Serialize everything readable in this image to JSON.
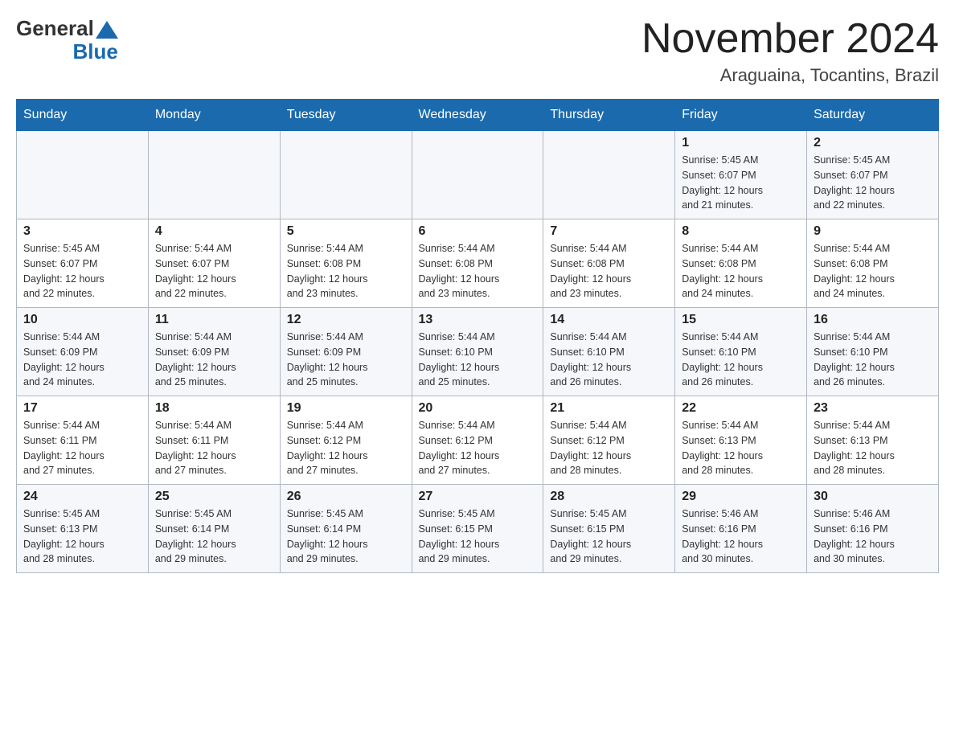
{
  "header": {
    "logo_general": "General",
    "logo_blue": "Blue",
    "month_title": "November 2024",
    "location": "Araguaina, Tocantins, Brazil"
  },
  "weekdays": [
    "Sunday",
    "Monday",
    "Tuesday",
    "Wednesday",
    "Thursday",
    "Friday",
    "Saturday"
  ],
  "rows": [
    [
      {
        "day": "",
        "info": ""
      },
      {
        "day": "",
        "info": ""
      },
      {
        "day": "",
        "info": ""
      },
      {
        "day": "",
        "info": ""
      },
      {
        "day": "",
        "info": ""
      },
      {
        "day": "1",
        "info": "Sunrise: 5:45 AM\nSunset: 6:07 PM\nDaylight: 12 hours\nand 21 minutes."
      },
      {
        "day": "2",
        "info": "Sunrise: 5:45 AM\nSunset: 6:07 PM\nDaylight: 12 hours\nand 22 minutes."
      }
    ],
    [
      {
        "day": "3",
        "info": "Sunrise: 5:45 AM\nSunset: 6:07 PM\nDaylight: 12 hours\nand 22 minutes."
      },
      {
        "day": "4",
        "info": "Sunrise: 5:44 AM\nSunset: 6:07 PM\nDaylight: 12 hours\nand 22 minutes."
      },
      {
        "day": "5",
        "info": "Sunrise: 5:44 AM\nSunset: 6:08 PM\nDaylight: 12 hours\nand 23 minutes."
      },
      {
        "day": "6",
        "info": "Sunrise: 5:44 AM\nSunset: 6:08 PM\nDaylight: 12 hours\nand 23 minutes."
      },
      {
        "day": "7",
        "info": "Sunrise: 5:44 AM\nSunset: 6:08 PM\nDaylight: 12 hours\nand 23 minutes."
      },
      {
        "day": "8",
        "info": "Sunrise: 5:44 AM\nSunset: 6:08 PM\nDaylight: 12 hours\nand 24 minutes."
      },
      {
        "day": "9",
        "info": "Sunrise: 5:44 AM\nSunset: 6:08 PM\nDaylight: 12 hours\nand 24 minutes."
      }
    ],
    [
      {
        "day": "10",
        "info": "Sunrise: 5:44 AM\nSunset: 6:09 PM\nDaylight: 12 hours\nand 24 minutes."
      },
      {
        "day": "11",
        "info": "Sunrise: 5:44 AM\nSunset: 6:09 PM\nDaylight: 12 hours\nand 25 minutes."
      },
      {
        "day": "12",
        "info": "Sunrise: 5:44 AM\nSunset: 6:09 PM\nDaylight: 12 hours\nand 25 minutes."
      },
      {
        "day": "13",
        "info": "Sunrise: 5:44 AM\nSunset: 6:10 PM\nDaylight: 12 hours\nand 25 minutes."
      },
      {
        "day": "14",
        "info": "Sunrise: 5:44 AM\nSunset: 6:10 PM\nDaylight: 12 hours\nand 26 minutes."
      },
      {
        "day": "15",
        "info": "Sunrise: 5:44 AM\nSunset: 6:10 PM\nDaylight: 12 hours\nand 26 minutes."
      },
      {
        "day": "16",
        "info": "Sunrise: 5:44 AM\nSunset: 6:10 PM\nDaylight: 12 hours\nand 26 minutes."
      }
    ],
    [
      {
        "day": "17",
        "info": "Sunrise: 5:44 AM\nSunset: 6:11 PM\nDaylight: 12 hours\nand 27 minutes."
      },
      {
        "day": "18",
        "info": "Sunrise: 5:44 AM\nSunset: 6:11 PM\nDaylight: 12 hours\nand 27 minutes."
      },
      {
        "day": "19",
        "info": "Sunrise: 5:44 AM\nSunset: 6:12 PM\nDaylight: 12 hours\nand 27 minutes."
      },
      {
        "day": "20",
        "info": "Sunrise: 5:44 AM\nSunset: 6:12 PM\nDaylight: 12 hours\nand 27 minutes."
      },
      {
        "day": "21",
        "info": "Sunrise: 5:44 AM\nSunset: 6:12 PM\nDaylight: 12 hours\nand 28 minutes."
      },
      {
        "day": "22",
        "info": "Sunrise: 5:44 AM\nSunset: 6:13 PM\nDaylight: 12 hours\nand 28 minutes."
      },
      {
        "day": "23",
        "info": "Sunrise: 5:44 AM\nSunset: 6:13 PM\nDaylight: 12 hours\nand 28 minutes."
      }
    ],
    [
      {
        "day": "24",
        "info": "Sunrise: 5:45 AM\nSunset: 6:13 PM\nDaylight: 12 hours\nand 28 minutes."
      },
      {
        "day": "25",
        "info": "Sunrise: 5:45 AM\nSunset: 6:14 PM\nDaylight: 12 hours\nand 29 minutes."
      },
      {
        "day": "26",
        "info": "Sunrise: 5:45 AM\nSunset: 6:14 PM\nDaylight: 12 hours\nand 29 minutes."
      },
      {
        "day": "27",
        "info": "Sunrise: 5:45 AM\nSunset: 6:15 PM\nDaylight: 12 hours\nand 29 minutes."
      },
      {
        "day": "28",
        "info": "Sunrise: 5:45 AM\nSunset: 6:15 PM\nDaylight: 12 hours\nand 29 minutes."
      },
      {
        "day": "29",
        "info": "Sunrise: 5:46 AM\nSunset: 6:16 PM\nDaylight: 12 hours\nand 30 minutes."
      },
      {
        "day": "30",
        "info": "Sunrise: 5:46 AM\nSunset: 6:16 PM\nDaylight: 12 hours\nand 30 minutes."
      }
    ]
  ]
}
